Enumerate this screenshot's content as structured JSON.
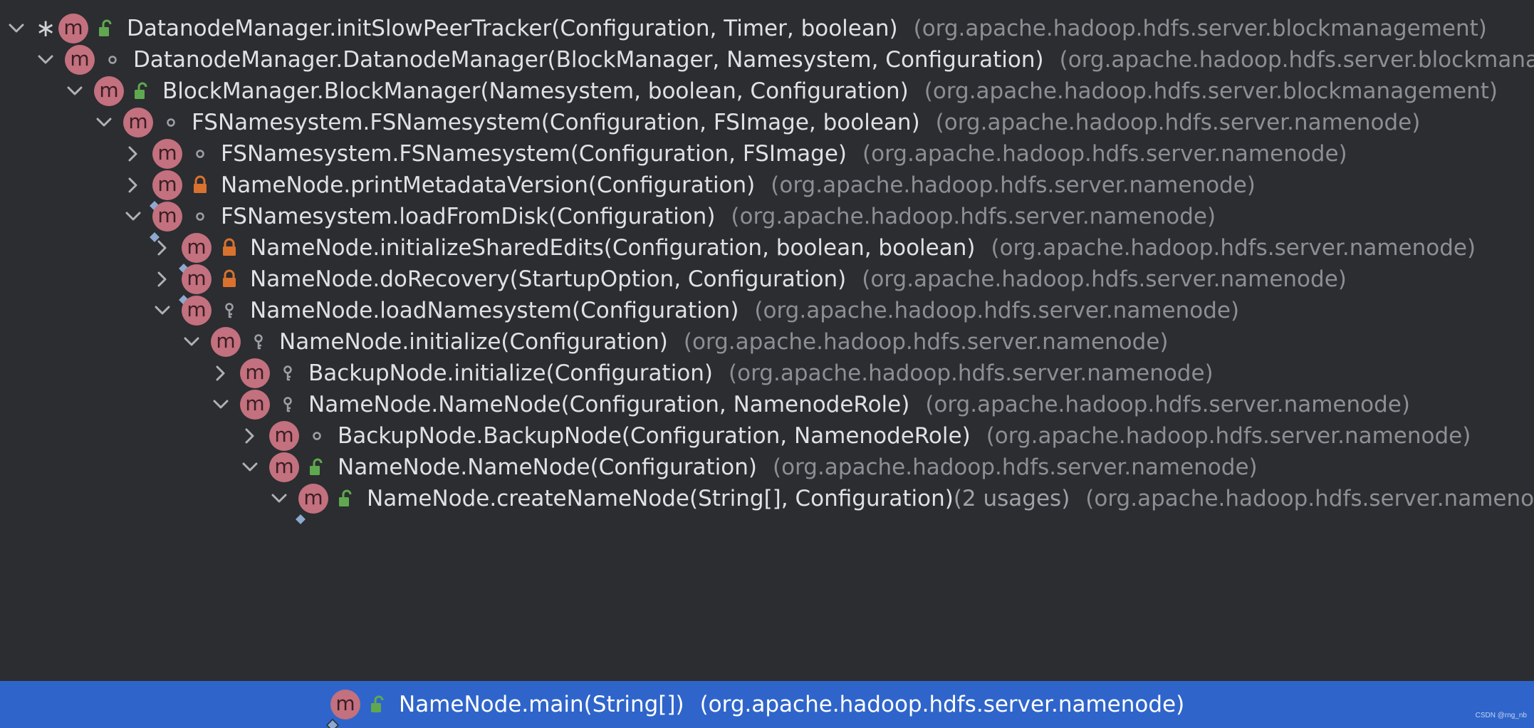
{
  "rows": [
    {
      "depth": 0,
      "arrow": "expanded",
      "star": true,
      "vis": "public",
      "override": false,
      "selected": false,
      "signature": "DatanodeManager.initSlowPeerTracker(Configuration, Timer, boolean)",
      "usages": "",
      "package": "(org.apache.hadoop.hdfs.server.blockmanagement)"
    },
    {
      "depth": 1,
      "arrow": "expanded",
      "star": false,
      "vis": "package",
      "override": false,
      "selected": false,
      "signature": "DatanodeManager.DatanodeManager(BlockManager, Namesystem, Configuration)",
      "usages": "",
      "package": "(org.apache.hadoop.hdfs.server.blockmanagement)"
    },
    {
      "depth": 2,
      "arrow": "expanded",
      "star": false,
      "vis": "public",
      "override": false,
      "selected": false,
      "signature": "BlockManager.BlockManager(Namesystem, boolean, Configuration)",
      "usages": "",
      "package": "(org.apache.hadoop.hdfs.server.blockmanagement)"
    },
    {
      "depth": 3,
      "arrow": "expanded",
      "star": false,
      "vis": "package",
      "override": false,
      "selected": false,
      "signature": "FSNamesystem.FSNamesystem(Configuration, FSImage, boolean)",
      "usages": "",
      "package": "(org.apache.hadoop.hdfs.server.namenode)"
    },
    {
      "depth": 4,
      "arrow": "collapsed",
      "star": false,
      "vis": "package",
      "override": false,
      "selected": false,
      "signature": "FSNamesystem.FSNamesystem(Configuration, FSImage)",
      "usages": "",
      "package": "(org.apache.hadoop.hdfs.server.namenode)"
    },
    {
      "depth": 4,
      "arrow": "collapsed",
      "star": false,
      "vis": "private",
      "override": true,
      "selected": false,
      "signature": "NameNode.printMetadataVersion(Configuration)",
      "usages": "",
      "package": "(org.apache.hadoop.hdfs.server.namenode)"
    },
    {
      "depth": 4,
      "arrow": "expanded",
      "star": false,
      "vis": "package",
      "override": true,
      "selected": false,
      "signature": "FSNamesystem.loadFromDisk(Configuration)",
      "usages": "",
      "package": "(org.apache.hadoop.hdfs.server.namenode)"
    },
    {
      "depth": 5,
      "arrow": "collapsed",
      "star": false,
      "vis": "private",
      "override": true,
      "selected": false,
      "signature": "NameNode.initializeSharedEdits(Configuration, boolean, boolean)",
      "usages": "",
      "package": "(org.apache.hadoop.hdfs.server.namenode)"
    },
    {
      "depth": 5,
      "arrow": "collapsed",
      "star": false,
      "vis": "private",
      "override": true,
      "selected": false,
      "signature": "NameNode.doRecovery(StartupOption, Configuration)",
      "usages": "",
      "package": "(org.apache.hadoop.hdfs.server.namenode)"
    },
    {
      "depth": 5,
      "arrow": "expanded",
      "star": false,
      "vis": "protected",
      "override": false,
      "selected": false,
      "signature": "NameNode.loadNamesystem(Configuration)",
      "usages": "",
      "package": "(org.apache.hadoop.hdfs.server.namenode)"
    },
    {
      "depth": 6,
      "arrow": "expanded",
      "star": false,
      "vis": "protected",
      "override": false,
      "selected": false,
      "signature": "NameNode.initialize(Configuration)",
      "usages": "",
      "package": "(org.apache.hadoop.hdfs.server.namenode)"
    },
    {
      "depth": 7,
      "arrow": "collapsed",
      "star": false,
      "vis": "protected",
      "override": false,
      "selected": false,
      "signature": "BackupNode.initialize(Configuration)",
      "usages": "",
      "package": "(org.apache.hadoop.hdfs.server.namenode)"
    },
    {
      "depth": 7,
      "arrow": "expanded",
      "star": false,
      "vis": "protected",
      "override": false,
      "selected": false,
      "signature": "NameNode.NameNode(Configuration, NamenodeRole)",
      "usages": "",
      "package": "(org.apache.hadoop.hdfs.server.namenode)"
    },
    {
      "depth": 8,
      "arrow": "collapsed",
      "star": false,
      "vis": "package",
      "override": false,
      "selected": false,
      "signature": "BackupNode.BackupNode(Configuration, NamenodeRole)",
      "usages": "",
      "package": "(org.apache.hadoop.hdfs.server.namenode)"
    },
    {
      "depth": 8,
      "arrow": "expanded",
      "star": false,
      "vis": "public",
      "override": false,
      "selected": false,
      "signature": "NameNode.NameNode(Configuration)",
      "usages": "",
      "package": "(org.apache.hadoop.hdfs.server.namenode)"
    },
    {
      "depth": 9,
      "arrow": "expanded",
      "star": false,
      "vis": "public",
      "override": true,
      "selected": false,
      "signature": "NameNode.createNameNode(String[], Configuration)",
      "usages": "(2 usages)",
      "package": "(org.apache.hadoop.hdfs.server.namenode)"
    },
    {
      "depth": 10,
      "arrow": "none",
      "star": false,
      "vis": "public",
      "override": true,
      "selected": true,
      "signature": "NameNode.main(String[])",
      "usages": "",
      "package": "(org.apache.hadoop.hdfs.server.namenode)"
    }
  ],
  "icon_letter": "m",
  "watermark": "CSDN @rng_nb",
  "colors": {
    "background": "#2b2d30",
    "selection": "#2f65ca",
    "method_icon": "#c3707f",
    "public_lock": "#5fa84f",
    "private_lock": "#d9722e",
    "package_text": "#8c8f94",
    "signature_text": "#dfe1e5"
  }
}
